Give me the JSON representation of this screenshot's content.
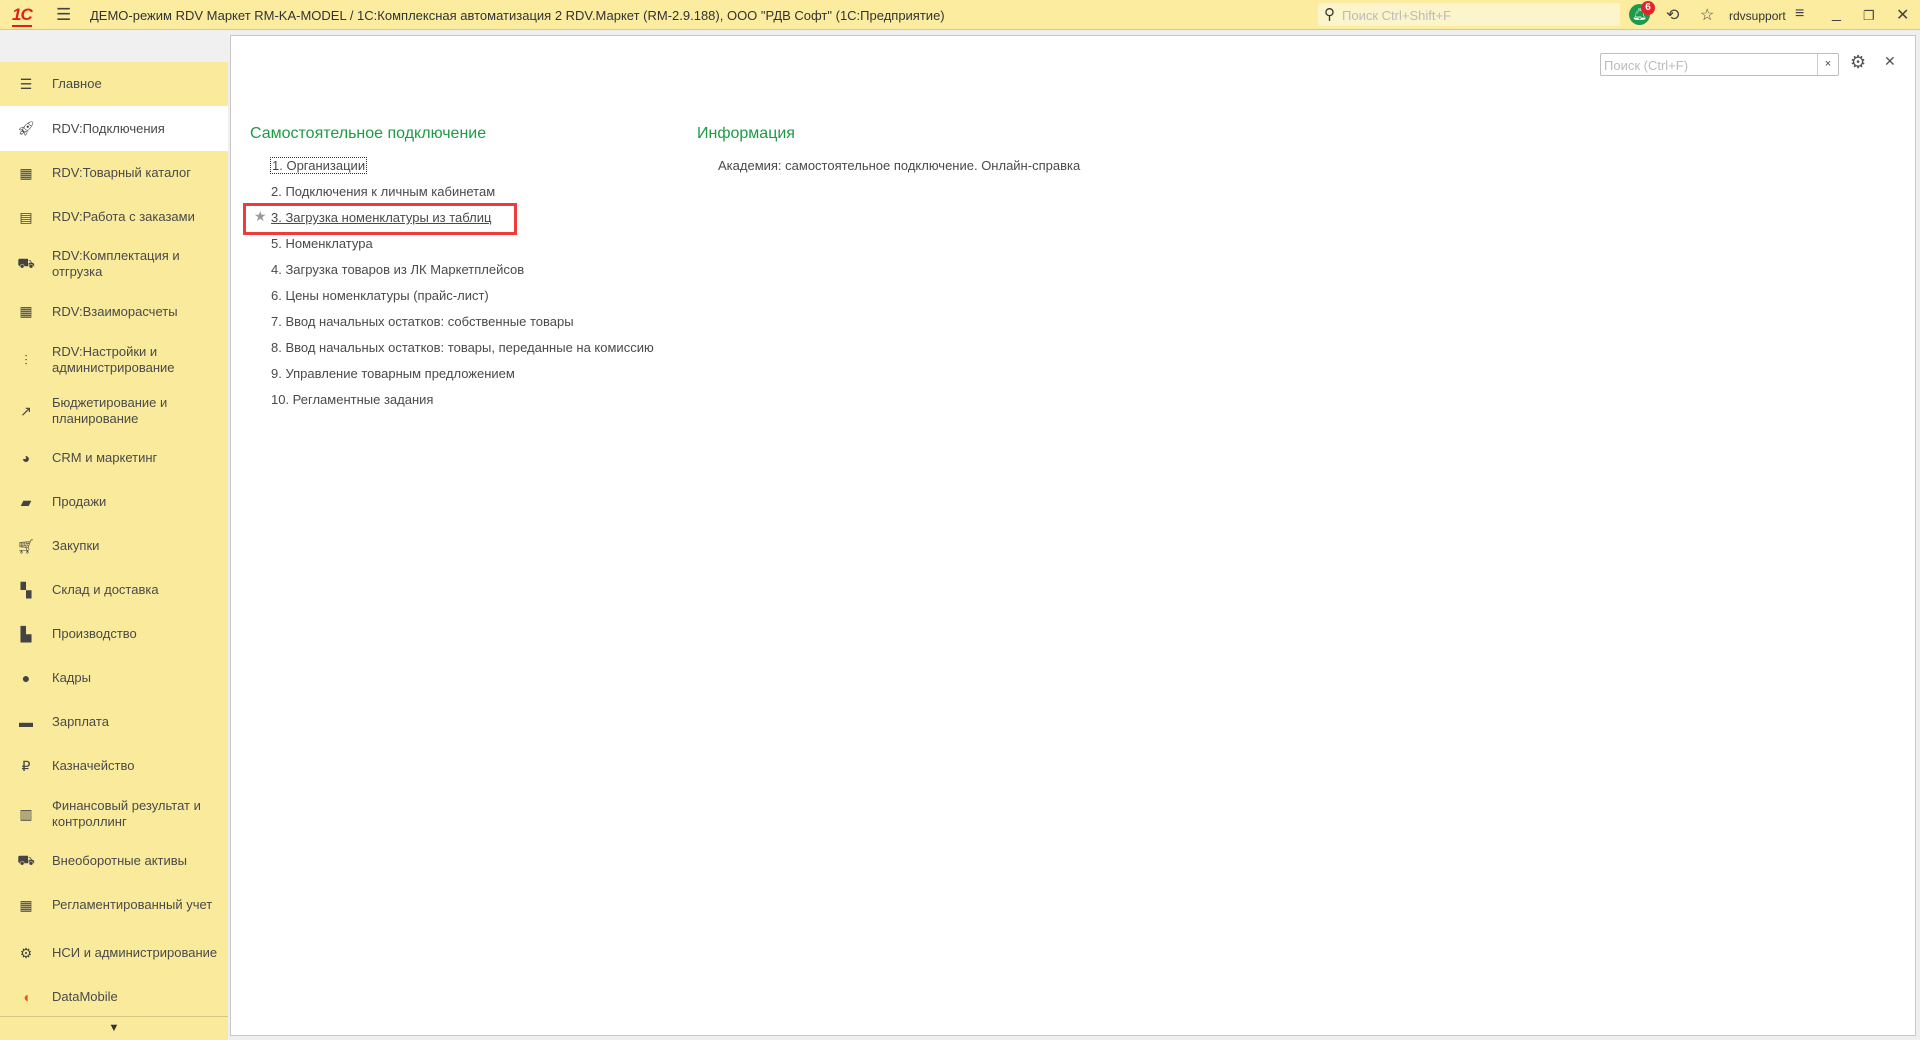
{
  "topbar": {
    "logo": "1С",
    "title": "ДЕМО-режим RDV Маркет RM-KA-MODEL / 1С:Комплексная автоматизация 2 RDV.Маркет (RM-2.9.188), ООО \"РДВ Софт\"  (1С:Предприятие)",
    "search_placeholder": "Поиск Ctrl+Shift+F",
    "notifications_count": "6",
    "user": "rdvsupport"
  },
  "sidebar": {
    "items": [
      {
        "label": "Главное",
        "icon": "menu-icon"
      },
      {
        "label": "RDV:Подключения",
        "icon": "rocket-icon"
      },
      {
        "label": "RDV:Товарный каталог",
        "icon": "catalog-icon"
      },
      {
        "label": "RDV:Работа с заказами",
        "icon": "orders-icon"
      },
      {
        "label": "RDV:Комплектация и отгрузка",
        "icon": "cart-dolly-icon"
      },
      {
        "label": "RDV:Взаиморасчеты",
        "icon": "calculator-icon"
      },
      {
        "label": "RDV:Настройки и администрирование",
        "icon": "sliders-icon"
      },
      {
        "label": "Бюджетирование и планирование",
        "icon": "budget-icon"
      },
      {
        "label": "CRM и маркетинг",
        "icon": "pie-chart-icon"
      },
      {
        "label": "Продажи",
        "icon": "bag-icon"
      },
      {
        "label": "Закупки",
        "icon": "cart-icon"
      },
      {
        "label": "Склад и доставка",
        "icon": "warehouse-icon"
      },
      {
        "label": "Производство",
        "icon": "factory-icon"
      },
      {
        "label": "Кадры",
        "icon": "person-icon"
      },
      {
        "label": "Зарплата",
        "icon": "card-icon"
      },
      {
        "label": "Казначейство",
        "icon": "ruble-icon"
      },
      {
        "label": "Финансовый результат и контроллинг",
        "icon": "bar-chart-icon"
      },
      {
        "label": "Внеоборотные активы",
        "icon": "truck-icon"
      },
      {
        "label": "Регламентированный учет",
        "icon": "calculator-icon"
      },
      {
        "label": "НСИ и администрирование",
        "icon": "gear-icon"
      },
      {
        "label": "DataMobile",
        "icon": "datamobile-icon"
      }
    ]
  },
  "main": {
    "search_placeholder": "Поиск (Ctrl+F)",
    "left_heading": "Самостоятельное подключение",
    "links": [
      "1. Организации",
      "2. Подключения к личным кабинетам",
      "3. Загрузка номенклатуры из таблиц",
      "5. Номенклатура",
      "4. Загрузка товаров из ЛК Маркетплейсов",
      "6. Цены номенклатуры (прайс-лист)",
      "7. Ввод начальных остатков: собственные товары",
      "8. Ввод начальных остатков: товары, переданные на комиссию",
      "9. Управление товарным предложением",
      "10. Регламентные задания"
    ],
    "right_heading": "Информация",
    "info_links": [
      "Академия: самостоятельное подключение. Онлайн-справка"
    ]
  },
  "colors": {
    "topbar": "#fbeca0",
    "sidebar": "#f9ea9c",
    "heading": "#1c9b44",
    "highlight": "#ef3b3b"
  }
}
